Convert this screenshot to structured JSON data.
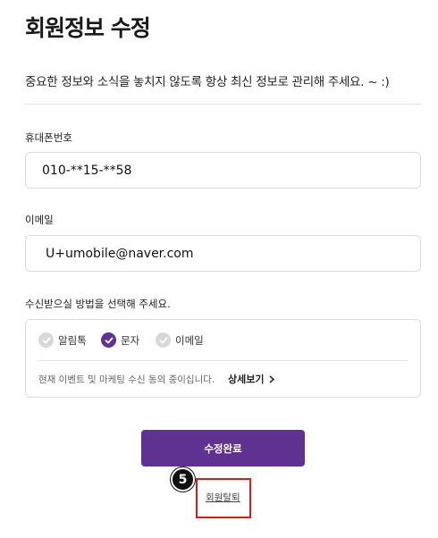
{
  "header": {
    "title": "회원정보 수정",
    "subtitle": "중요한 정보와 소식을 놓치지 않도록 항상 최신 정보로 관리해 주세요. ~ :)"
  },
  "phone": {
    "label": "휴대폰번호",
    "value": "010-**15-**58"
  },
  "email": {
    "label": "이메일",
    "value": "U+umobile@naver.com"
  },
  "receive": {
    "label": "수신받으실 방법을 선택해 주세요.",
    "options": [
      {
        "label": "알림톡",
        "checked": false,
        "icon": "check-circle-icon"
      },
      {
        "label": "문자",
        "checked": true,
        "icon": "check-circle-icon"
      },
      {
        "label": "이메일",
        "checked": false,
        "icon": "check-circle-icon"
      }
    ],
    "consent_text": "현재 이벤트 및 마케팅 수신 동의 중이십니다.",
    "detail_link": "상세보기",
    "detail_icon": "chevron-right-icon"
  },
  "actions": {
    "submit_label": "수정완료",
    "withdraw_label": "회원탈퇴"
  },
  "annotation": {
    "step_number": "5",
    "highlight_color": "#e01818"
  },
  "colors": {
    "accent": "#5f3190",
    "check_off": "#d8d8d8"
  }
}
